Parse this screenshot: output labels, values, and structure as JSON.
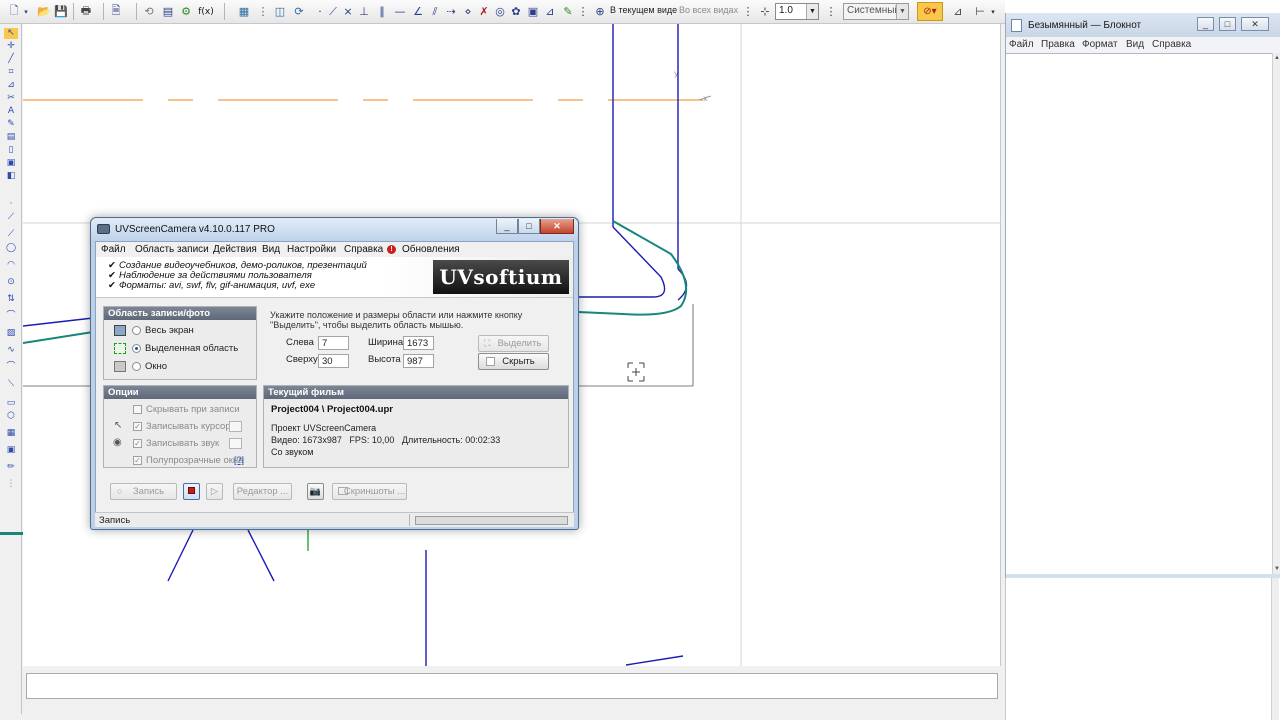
{
  "cad": {
    "toolbar": {
      "view_current": "В текущем виде",
      "view_all": "Во всех видах",
      "zoom_value": "1.0",
      "style_value": "Системный",
      "fx_label": "f(x)",
      "icons": [
        "new-icon",
        "open-icon",
        "save-icon",
        "print-icon",
        "preview-icon",
        "undo-icon",
        "redo-icon",
        "properties-icon",
        "variables-icon",
        "zoom-icon",
        "grid-icon",
        "snap-icon"
      ]
    },
    "canvas": {
      "line_color_blue": "#1b1bb5",
      "line_color_teal": "#16877a",
      "line_color_orange": "#f0a040"
    },
    "left_tools": [
      "select-tool-icon",
      "line-tool-icon",
      "circle-tool-icon",
      "arc-tool-icon",
      "rectangle-tool-icon",
      "polyline-tool-icon",
      "spline-tool-icon",
      "hatch-tool-icon",
      "dimension-tool-icon",
      "text-tool-icon",
      "measure-tool-icon",
      "edit-tool-icon"
    ]
  },
  "notepad": {
    "title": "Безымянный — Блокнот",
    "menus": [
      "Файл",
      "Правка",
      "Формат",
      "Вид",
      "Справка"
    ],
    "controls": [
      "_",
      "□",
      "✕"
    ]
  },
  "uv": {
    "title": "UVScreenCamera v4.10.0.117 PRO",
    "controls": [
      "_",
      "□",
      "✕"
    ],
    "menus": [
      "Файл",
      "Область записи",
      "Действия",
      "Вид",
      "Настройки",
      "Справка",
      "Обновления"
    ],
    "features": [
      "Создание видеоучебников, демо-роликов, презентаций",
      "Наблюдение за действиями пользователя",
      "Форматы: avi, swf, flv, gif-анимация, uvf, exe"
    ],
    "logo": "UVsoftium",
    "area": {
      "title": "Область записи/фото",
      "options": [
        "Весь экран",
        "Выделенная область",
        "Окно"
      ],
      "selected": "Выделенная область"
    },
    "area_settings": {
      "hint": "Укажите положение и размеры области или нажмите кнопку \"Выделить\", чтобы выделить область мышью.",
      "left_label": "Слева",
      "left_value": "7",
      "top_label": "Сверху",
      "top_value": "30",
      "width_label": "Ширина",
      "width_value": "1673",
      "height_label": "Высота",
      "height_value": "987",
      "select_button": "Выделить",
      "hide_button": "Скрыть"
    },
    "options": {
      "title": "Опции",
      "hide_on_record": "Скрывать при записи",
      "record_cursor": "Записывать курсор",
      "record_sound": "Записывать звук",
      "transparent_windows": "Полупрозрачные окна",
      "help_link": "[?]"
    },
    "movie": {
      "title": "Текущий фильм",
      "path": "Project004 \\ Project004.upr",
      "project": "Проект UVScreenCamera",
      "video": "Видео: 1673x987   FPS: 10,00   Длительность: 00:02:33",
      "sound": "Со звуком"
    },
    "actions": {
      "record": "Запись",
      "editor": "Редактор ...",
      "screenshots": "Скриншоты ..."
    },
    "status": "Запись"
  }
}
